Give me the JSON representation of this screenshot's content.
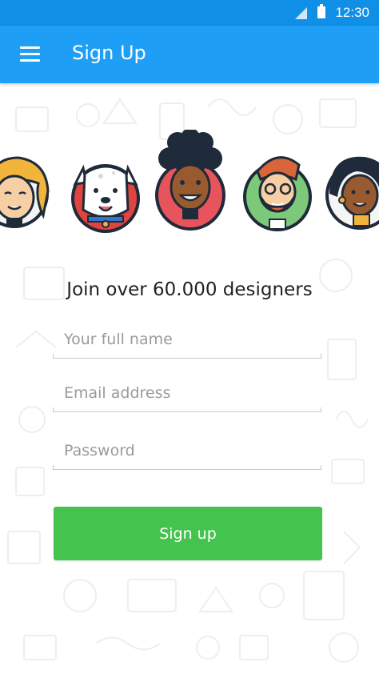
{
  "status_bar": {
    "time": "12:30"
  },
  "app_bar": {
    "title": "Sign Up"
  },
  "headline": "Join over 60.000 designers",
  "form": {
    "full_name": {
      "placeholder": "Your full name",
      "value": ""
    },
    "email": {
      "placeholder": "Email address",
      "value": ""
    },
    "password": {
      "placeholder": "Password",
      "value": ""
    },
    "submit_label": "Sign up"
  },
  "avatars": [
    "woman-blonde",
    "dog",
    "man-afro",
    "man-beard-glasses",
    "woman-dark-hair"
  ],
  "colors": {
    "status_bar": "#0f8fe6",
    "app_bar": "#1e9ef5",
    "button": "#45c34f",
    "avatar_rings": [
      "#1f2a3a"
    ],
    "avatar_backgrounds": [
      "#f6f6f6",
      "#e0443f",
      "#e8545c",
      "#7cc97a",
      "#f5f5f5"
    ]
  }
}
